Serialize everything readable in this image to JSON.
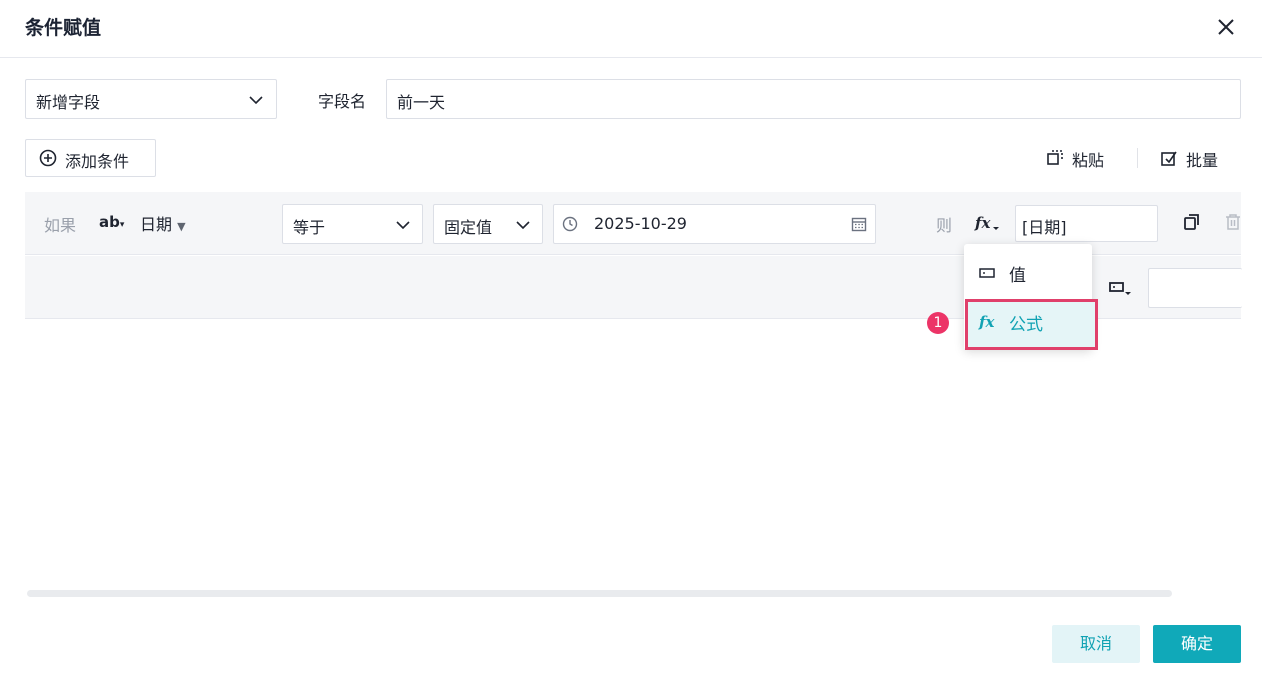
{
  "dialog": {
    "title": "条件赋值"
  },
  "field_type": {
    "selected": "新增字段"
  },
  "field_name": {
    "label": "字段名",
    "value": "前一天"
  },
  "toolbar": {
    "add_condition": "添加条件",
    "paste": "粘贴",
    "batch": "批量"
  },
  "condition": {
    "if_label": "如果",
    "field_type_icon": "ab",
    "field": "日期",
    "operator": "等于",
    "value_type": "固定值",
    "date_value": "2025-10-29",
    "then_label": "则",
    "result_value": "[日期]"
  },
  "dropdown": {
    "items": [
      {
        "label": "值",
        "icon": "value-box-icon"
      },
      {
        "label": "公式",
        "icon": "fx-icon"
      }
    ]
  },
  "annotation": {
    "badge": "1"
  },
  "footer": {
    "cancel": "取消",
    "confirm": "确定"
  },
  "colors": {
    "accent": "#10a9b9",
    "highlight": "#e0406b",
    "badge": "#ec3467"
  }
}
